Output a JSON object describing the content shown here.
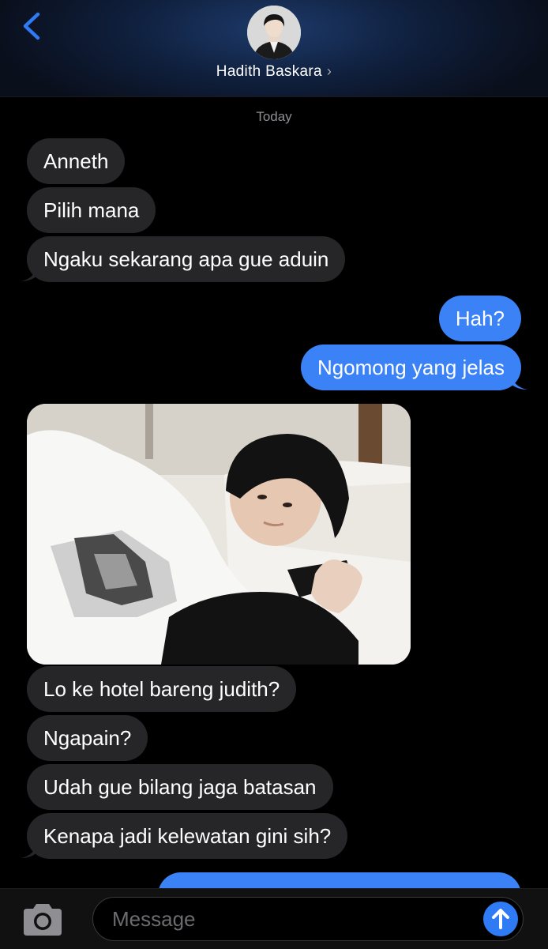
{
  "header": {
    "contact_name": "Hadith Baskara",
    "chevron": "›"
  },
  "thread": {
    "date_label": "Today",
    "messages": [
      {
        "from": "them",
        "text": "Anneth"
      },
      {
        "from": "them",
        "text": "Pilih mana"
      },
      {
        "from": "them",
        "text": "Ngaku sekarang apa gue aduin"
      },
      {
        "from": "me",
        "text": "Hah?"
      },
      {
        "from": "me",
        "text": "Ngomong yang jelas"
      },
      {
        "from": "them",
        "type": "photo"
      },
      {
        "from": "them",
        "text": "Lo ke hotel bareng judith?"
      },
      {
        "from": "them",
        "text": "Ngapain?"
      },
      {
        "from": "them",
        "text": "Udah gue bilang jaga batasan"
      },
      {
        "from": "them",
        "text": "Kenapa jadi kelewatan gini sih?"
      }
    ]
  },
  "composer": {
    "placeholder": "Message"
  },
  "colors": {
    "sent_bubble": "#3b82f6",
    "received_bubble": "#262628",
    "accent": "#2f7bf5"
  },
  "icons": [
    "back-chevron-icon",
    "camera-icon",
    "send-arrow-icon"
  ]
}
